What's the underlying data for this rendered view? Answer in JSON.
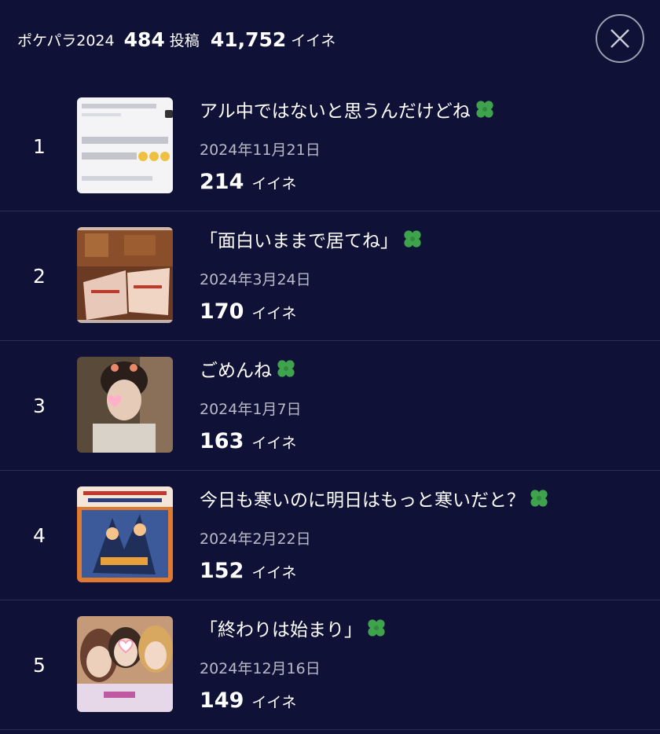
{
  "header": {
    "app_label": "ポケパラ2024",
    "posts_count": "484",
    "posts_unit": "投稿",
    "likes_total": "41,752",
    "likes_unit": "イイネ"
  },
  "items": [
    {
      "rank": "1",
      "title": "アル中ではないと思うんだけどね",
      "date": "2024年11月21日",
      "likes": "214",
      "likes_unit": "イイネ"
    },
    {
      "rank": "2",
      "title": "「面白いままで居てね」",
      "date": "2024年3月24日",
      "likes": "170",
      "likes_unit": "イイネ"
    },
    {
      "rank": "3",
      "title": "ごめんね",
      "date": "2024年1月7日",
      "likes": "163",
      "likes_unit": "イイネ"
    },
    {
      "rank": "4",
      "title": "今日も寒いのに明日はもっと寒いだと？",
      "date": "2024年2月22日",
      "likes": "152",
      "likes_unit": "イイネ"
    },
    {
      "rank": "5",
      "title": "「終わりは始まり」",
      "date": "2024年12月16日",
      "likes": "149",
      "likes_unit": "イイネ"
    }
  ],
  "icons": {
    "clover": "clover-icon",
    "close": "close-icon"
  },
  "colors": {
    "background": "#0f1236",
    "divider": "#2a2e52",
    "clover": "#3fa34d",
    "date": "#b7bac8"
  }
}
